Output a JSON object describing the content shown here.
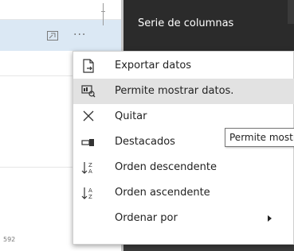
{
  "panel": {
    "title": "Serie de columnas"
  },
  "visual": {
    "value_label": "592"
  },
  "menu": {
    "items": [
      {
        "label": "Exportar datos",
        "icon": "export-data-icon"
      },
      {
        "label": "Permite mostrar datos.",
        "icon": "show-data-icon",
        "highlighted": true
      },
      {
        "label": "Quitar",
        "icon": "close-icon"
      },
      {
        "label": "Destacados",
        "icon": "spotlight-icon"
      },
      {
        "label": "Orden descendente",
        "icon": "sort-descending-icon"
      },
      {
        "label": "Orden ascendente",
        "icon": "sort-ascending-icon"
      },
      {
        "label": "Ordenar por",
        "icon": "",
        "submenu": true
      }
    ]
  },
  "tooltip": {
    "text": "Permite mostrar datos."
  },
  "colors": {
    "panel_bg": "#2b2b2b",
    "header_bg": "#dbe8f4",
    "highlight": "#e2e2e2"
  }
}
